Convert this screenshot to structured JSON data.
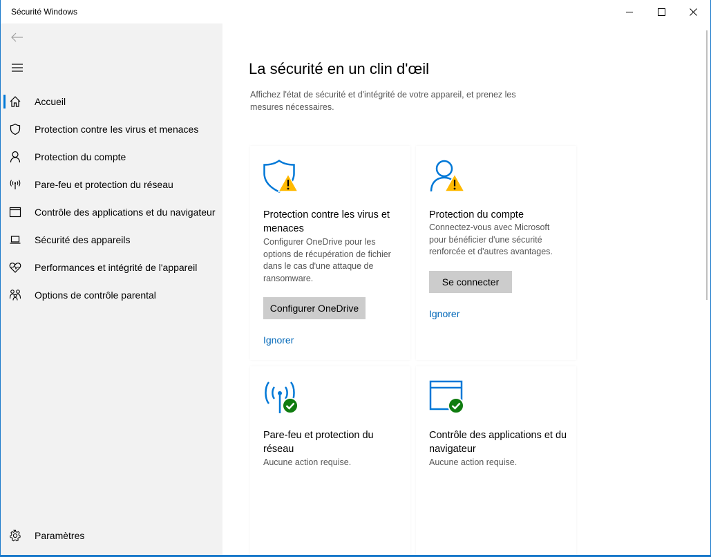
{
  "window": {
    "title": "Sécurité Windows"
  },
  "sidebar": {
    "back_icon": "arrow-left-icon",
    "menu_icon": "hamburger-icon",
    "items": [
      {
        "label": "Accueil",
        "icon": "home-icon",
        "active": true
      },
      {
        "label": "Protection contre les virus et menaces",
        "icon": "shield-icon"
      },
      {
        "label": "Protection du compte",
        "icon": "person-icon"
      },
      {
        "label": "Pare-feu et protection du réseau",
        "icon": "antenna-icon"
      },
      {
        "label": "Contrôle des applications et du navigateur",
        "icon": "app-window-icon"
      },
      {
        "label": "Sécurité des appareils",
        "icon": "laptop-icon"
      },
      {
        "label": "Performances et intégrité de l'appareil",
        "icon": "heart-pulse-icon"
      },
      {
        "label": "Options de contrôle parental",
        "icon": "family-icon"
      }
    ],
    "settings": {
      "label": "Paramètres",
      "icon": "gear-icon"
    }
  },
  "main": {
    "title": "La sécurité en un clin d'œil",
    "description": "Affichez l'état de sécurité et d'intégrité de votre appareil, et prenez les mesures nécessaires.",
    "cards": [
      {
        "title": "Protection contre les virus et menaces",
        "description": "Configurer OneDrive pour les options de récupération de fichier dans le cas d'une attaque de ransomware.",
        "button": "Configurer OneDrive",
        "link": "Ignorer",
        "status": "warning",
        "icon": "shield-warning-icon"
      },
      {
        "title": "Protection du compte",
        "description": "Connectez-vous avec Microsoft pour bénéficier d'une sécurité renforcée et d'autres avantages.",
        "button": "Se connecter",
        "link": "Ignorer",
        "status": "warning",
        "icon": "person-warning-icon"
      },
      {
        "title": "Pare-feu et protection du réseau",
        "description": "Aucune action requise.",
        "status": "ok",
        "icon": "antenna-check-icon"
      },
      {
        "title": "Contrôle des applications et du navigateur",
        "description": "Aucune action requise.",
        "status": "ok",
        "icon": "app-window-check-icon"
      }
    ]
  },
  "colors": {
    "accent": "#0078d7",
    "link": "#0067b8",
    "warning": "#ffb900",
    "ok": "#107c10",
    "sidebar_bg": "#f2f2f2",
    "button_bg": "#cccccc"
  }
}
